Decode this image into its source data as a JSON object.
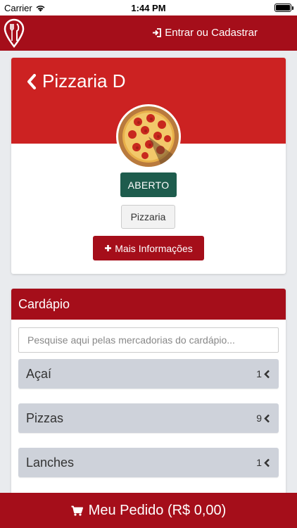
{
  "status_bar": {
    "carrier": "Carrier",
    "time": "1:44 PM"
  },
  "header": {
    "login_label": "Entrar ou Cadastrar"
  },
  "store": {
    "name": "Pizzaria D",
    "status": "ABERTO",
    "category": "Pizzaria",
    "info_button": "Mais Informações"
  },
  "menu": {
    "title": "Cardápio",
    "search_placeholder": "Pesquise aqui pelas mercadorias do cardápio...",
    "items": [
      {
        "name": "Açaí",
        "count": "1"
      },
      {
        "name": "Pizzas",
        "count": "9"
      },
      {
        "name": "Lanches",
        "count": "1"
      }
    ]
  },
  "order": {
    "label": "Meu Pedido (R$ 0,00)"
  },
  "colors": {
    "brand": "#a50e1a",
    "banner": "#cc2222",
    "open": "#1e5c4d"
  }
}
